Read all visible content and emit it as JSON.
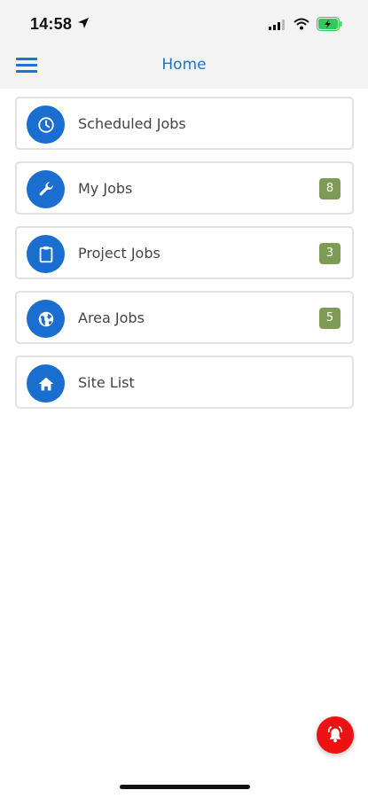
{
  "status_bar": {
    "time": "14:58",
    "location_icon": "location-arrow-icon",
    "signal_icon": "cellular-signal-icon",
    "wifi_icon": "wifi-icon",
    "battery_icon": "battery-charging-icon",
    "battery_color": "#34c759"
  },
  "nav": {
    "title": "Home",
    "menu_icon": "hamburger-menu-icon"
  },
  "colors": {
    "accent": "#1e73d2",
    "icon_circle": "#1a6ed0",
    "badge": "#7e9b56",
    "fab": "#ee1111"
  },
  "menu_items": [
    {
      "label": "Scheduled Jobs",
      "icon": "clock-icon",
      "badge": null
    },
    {
      "label": "My Jobs",
      "icon": "wrench-icon",
      "badge": "8"
    },
    {
      "label": "Project Jobs",
      "icon": "clipboard-icon",
      "badge": "3"
    },
    {
      "label": "Area Jobs",
      "icon": "globe-icon",
      "badge": "5"
    },
    {
      "label": "Site List",
      "icon": "home-icon",
      "badge": null
    }
  ],
  "fab": {
    "icon": "alarm-bell-icon"
  }
}
